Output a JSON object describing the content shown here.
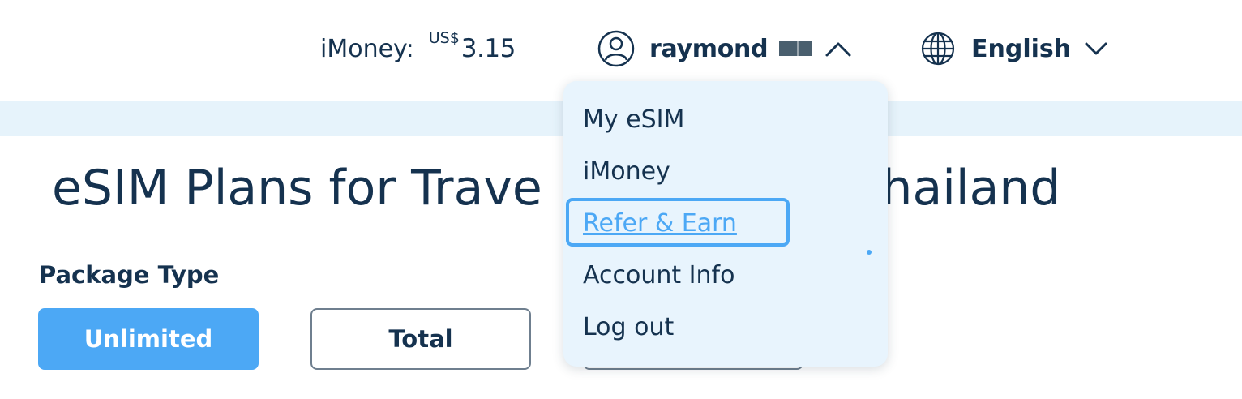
{
  "header": {
    "imoney_label": "iMoney:",
    "imoney_currency": "US$",
    "imoney_amount": "3.15",
    "user_name": "raymond",
    "language": "English"
  },
  "main": {
    "title": "eSIM Plans for Trave",
    "title_tail": "Thailand",
    "package_type_label": "Package Type",
    "package_types": [
      "Unlimited",
      "Total"
    ]
  },
  "user_menu": {
    "items": [
      "My eSIM",
      "iMoney",
      "Refer & Earn",
      "Account Info",
      "Log out"
    ],
    "focused_item": "Refer & Earn"
  },
  "colors": {
    "accent": "#4ca8f5",
    "text": "#15324f",
    "banner": "#e6f3fb",
    "menu_bg": "#e8f4fd"
  },
  "icons": [
    "user-circle-icon",
    "chevron-up-icon",
    "globe-icon",
    "chevron-down-icon"
  ]
}
